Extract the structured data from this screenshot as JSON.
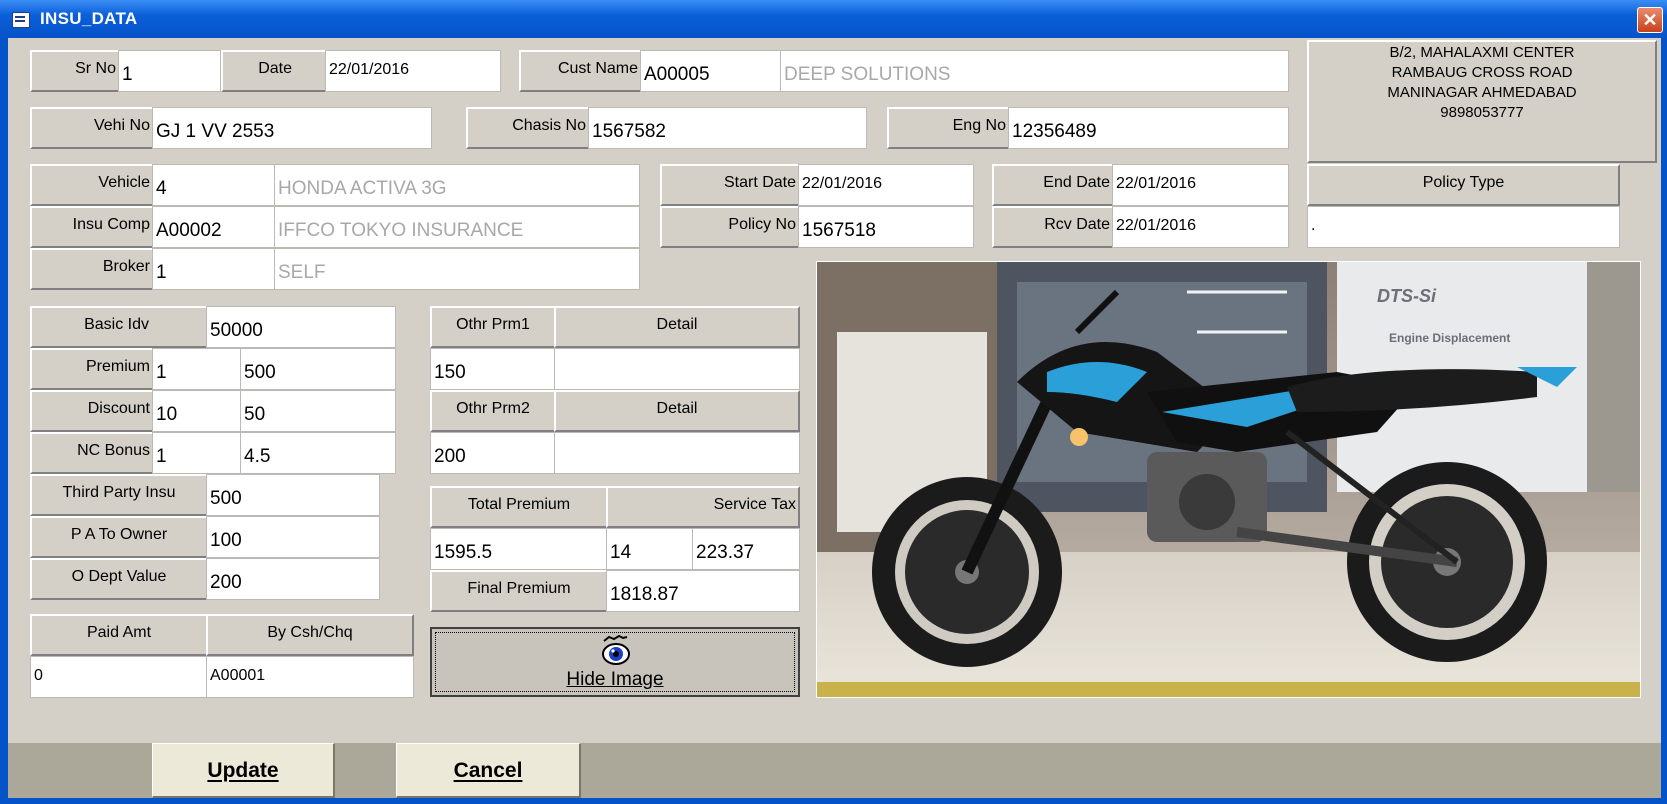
{
  "window": {
    "title": "INSU_DATA",
    "close_glyph": "✕"
  },
  "header": {
    "sr_no_label": "Sr No",
    "sr_no": "1",
    "date_label": "Date",
    "date": "22/01/2016",
    "cust_name_label": "Cust Name",
    "cust_code": "A00005",
    "cust_name": "DEEP SOLUTIONS",
    "vehi_no_label": "Vehi No",
    "vehi_no": "GJ 1 VV 2553",
    "chasis_no_label": "Chasis No",
    "chasis_no": "1567582",
    "eng_no_label": "Eng No",
    "eng_no": "12356489",
    "address_lines": [
      "B/2, MAHALAXMI CENTER",
      "RAMBAUG CROSS ROAD",
      "MANINAGAR AHMEDABAD",
      "9898053777"
    ]
  },
  "vehicle": {
    "vehicle_label": "Vehicle",
    "vehicle_code": "4",
    "vehicle_name": "HONDA ACTIVA 3G",
    "insu_comp_label": "Insu Comp",
    "insu_comp_code": "A00002",
    "insu_comp_name": "IFFCO TOKYO INSURANCE",
    "broker_label": "Broker",
    "broker_code": "1",
    "broker_name": "SELF"
  },
  "policy": {
    "start_date_label": "Start Date",
    "start_date": "22/01/2016",
    "end_date_label": "End Date",
    "end_date": "22/01/2016",
    "policy_type_label": "Policy Type",
    "policy_type": ".",
    "policy_no_label": "Policy No",
    "policy_no": "1567518",
    "rcv_date_label": "Rcv Date",
    "rcv_date": "22/01/2016"
  },
  "premium": {
    "basic_idv_label": "Basic Idv",
    "basic_idv": "50000",
    "premium_label": "Premium",
    "premium_pct": "1",
    "premium_amt": "500",
    "discount_label": "Discount",
    "discount_pct": "10",
    "discount_amt": "50",
    "nc_bonus_label": "NC Bonus",
    "nc_bonus_pct": "1",
    "nc_bonus_amt": "4.5",
    "third_party_label": "Third Party Insu",
    "third_party": "500",
    "pa_owner_label": "P A To Owner",
    "pa_owner": "100",
    "o_dept_label": "O Dept Value",
    "o_dept": "200",
    "paid_amt_label": "Paid Amt",
    "paid_amt": "0",
    "by_cash_label": "By Csh/Chq",
    "by_cash": "A00001"
  },
  "other": {
    "othr_prm1_label": "Othr Prm1",
    "detail1_label": "Detail",
    "othr_prm1": "150",
    "detail1": "",
    "othr_prm2_label": "Othr Prm2",
    "detail2_label": "Detail",
    "othr_prm2": "200",
    "detail2": "",
    "total_premium_label": "Total Premium",
    "service_tax_label": "Service Tax",
    "total_premium": "1595.5",
    "service_tax_pct": "14",
    "service_tax_amt": "223.37",
    "final_premium_label": "Final Premium",
    "final_premium": "1818.87"
  },
  "buttons": {
    "hide_image": "Hide Image",
    "update": "Update",
    "cancel": "Cancel"
  },
  "icons": {
    "title": "form-icon",
    "hide_image": "eye-icon",
    "close": "close-icon"
  }
}
